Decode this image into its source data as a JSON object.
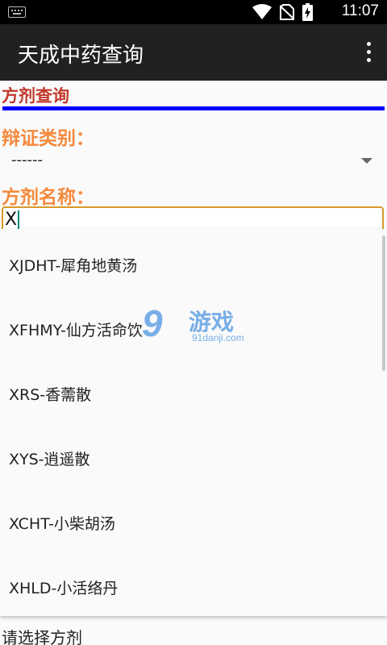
{
  "status_bar": {
    "time": "11:07",
    "icons": [
      "keyboard-icon",
      "wifi-icon",
      "no-sim-icon",
      "battery-charging-icon"
    ]
  },
  "app_bar": {
    "title": "天成中药查询",
    "menu_icon": "more-vert-icon"
  },
  "section": {
    "title": "方剂查询",
    "accent_color": "#0000ff"
  },
  "form": {
    "category_label": "辩证类别：",
    "category_value": "------",
    "name_label": "方剂名称：",
    "name_value": "X"
  },
  "suggestions": [
    "XJDHT-犀角地黄汤",
    "XFHMY-仙方活命饮",
    "XRS-香薷散",
    "XYS-逍遥散",
    "XCHT-小柴胡汤",
    "XHLD-小活络丹"
  ],
  "hint": "请选择方剂",
  "watermark": {
    "mark": "9",
    "name": "游戏",
    "domain": "91danji.com"
  },
  "colors": {
    "status_bar": "#000000",
    "app_bar": "#212121",
    "section_title": "#c0392b",
    "label": "#f5893b",
    "input_border": "#d89a2a",
    "caret": "#00897b"
  }
}
